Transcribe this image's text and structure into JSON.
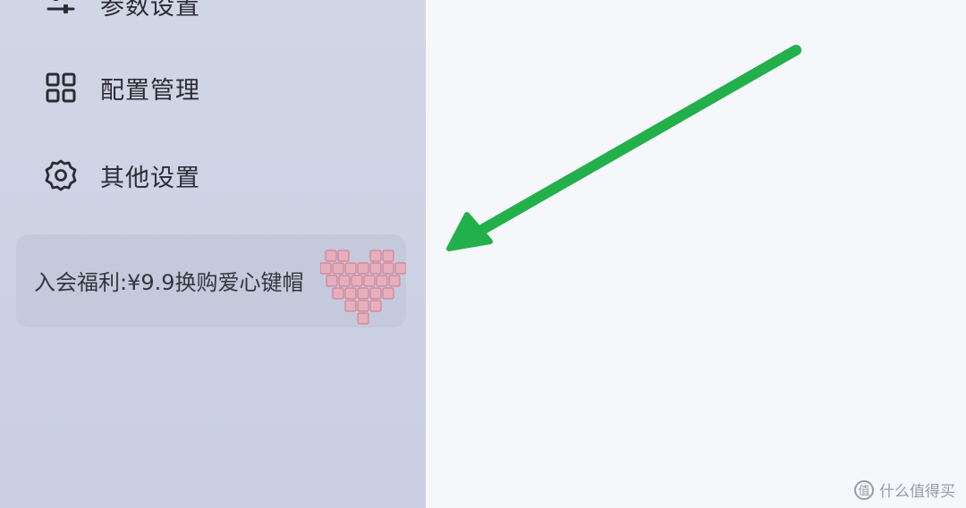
{
  "sidebar": {
    "items": [
      {
        "label": "参数设置",
        "icon": "sliders-icon"
      },
      {
        "label": "配置管理",
        "icon": "grid-icon"
      },
      {
        "label": "其他设置",
        "icon": "gear-icon"
      }
    ],
    "promo": {
      "text": "入会福利:¥9.9换购爱心键帽",
      "image": "heart-keycaps-image"
    }
  },
  "annotation": {
    "arrow_color": "#22b04b"
  },
  "watermark": {
    "icon_glyph": "值",
    "text": "什么值得买"
  },
  "colors": {
    "sidebar_bg": "#cfd4e5",
    "main_bg": "#f6f7fb",
    "heart": "#e07a8a"
  }
}
